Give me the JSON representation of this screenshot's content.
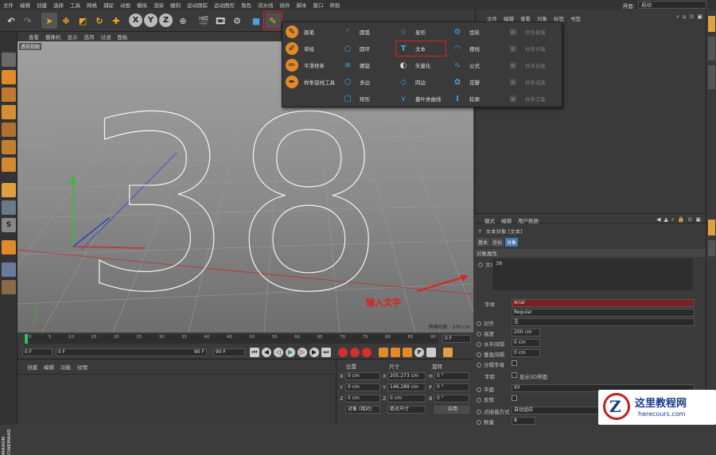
{
  "menubar": {
    "items": [
      "文件",
      "编辑",
      "创建",
      "选择",
      "工具",
      "网格",
      "捕捉",
      "动画",
      "模拟",
      "渲染",
      "雕刻",
      "运动跟踪",
      "运动图形",
      "角色",
      "流水线",
      "插件",
      "脚本",
      "窗口",
      "帮助"
    ],
    "layout_label": "界面:",
    "layout_value": "启动"
  },
  "viewport": {
    "menu": [
      "查看",
      "摄像机",
      "显示",
      "选项",
      "过滤",
      "面板"
    ],
    "label": "透视视图",
    "text_3d": "38",
    "grid_spacing": "网格间距 : 100 cm"
  },
  "timeline": {
    "ticks": [
      "0",
      "5",
      "10",
      "15",
      "20",
      "25",
      "30",
      "35",
      "40",
      "45",
      "50",
      "55",
      "60",
      "65",
      "70",
      "75",
      "80",
      "85",
      "90"
    ],
    "current_frame": "0 F"
  },
  "transport": {
    "start": "0 F",
    "min": "0 F",
    "max": "90 F",
    "end": "90 F"
  },
  "material_panel": {
    "menu": [
      "创建",
      "编辑",
      "功能",
      "纹理"
    ]
  },
  "coords": {
    "headers": [
      "位置",
      "尺寸",
      "旋转"
    ],
    "rows": [
      {
        "axis": "X",
        "pos": "0 cm",
        "size_axis": "X",
        "size": "205.273 cm",
        "rot_axis": "H",
        "rot": "0 °"
      },
      {
        "axis": "Y",
        "pos": "0 cm",
        "size_axis": "Y",
        "size": "146.289 cm",
        "rot_axis": "P",
        "rot": "0 °"
      },
      {
        "axis": "Z",
        "pos": "0 cm",
        "size_axis": "Z",
        "size": "0 cm",
        "rot_axis": "B",
        "rot": "0 °"
      }
    ],
    "mode": "对象 (相对)",
    "size_mode": "绝对尺寸",
    "apply": "应用"
  },
  "object_manager": {
    "menu": [
      "文件",
      "编辑",
      "查看",
      "对象",
      "标签",
      "书签"
    ]
  },
  "attributes": {
    "menu": [
      "模式",
      "编辑",
      "用户数据"
    ],
    "title": "文本对象 [文本]",
    "tabs": [
      "基本",
      "坐标",
      "对象"
    ],
    "section": "对象属性",
    "text_label": "文本",
    "text_value": "38",
    "font_label": "字体",
    "font_value": "Arial",
    "style_value": "Regular",
    "align_label": "对齐",
    "align_value": "左",
    "height_label": "高度",
    "height_value": "200 cm",
    "hspace_label": "水平间隔",
    "hspace_value": "0 cm",
    "vspace_label": "垂直间隔",
    "vspace_value": "0 cm",
    "separate_label": "分隔字母",
    "kerning_label": "字距",
    "show3d_label": "显示3D界面",
    "plane_label": "平面",
    "plane_value": "XY",
    "reverse_label": "反转",
    "interp_label": "点插值方式",
    "interp_value": "自动适应",
    "count_label": "数量",
    "count_value": "8"
  },
  "annotation": {
    "text": "输入文字",
    "color": "#e02020"
  },
  "spline_menu": {
    "col1": [
      "画笔",
      "草绘",
      "平滑样条",
      "样条弧线工具"
    ],
    "col2": [
      "圆弧",
      "圆环",
      "螺旋",
      "多边",
      "矩形"
    ],
    "col3": [
      "星形",
      "文本",
      "矢量化",
      "四边",
      "蔓叶类曲线"
    ],
    "col4": [
      "齿轮",
      "摆线",
      "公式",
      "花瓣",
      "轮廓"
    ],
    "col5": [
      "样条差集",
      "样条并集",
      "样条合集",
      "样条或集",
      "样条交集"
    ]
  },
  "leftbar": {
    "logo_lines": [
      "MAXON",
      "CINEMA4D"
    ]
  },
  "watermark": {
    "title": "这里教程网",
    "url": "herecours.com"
  }
}
